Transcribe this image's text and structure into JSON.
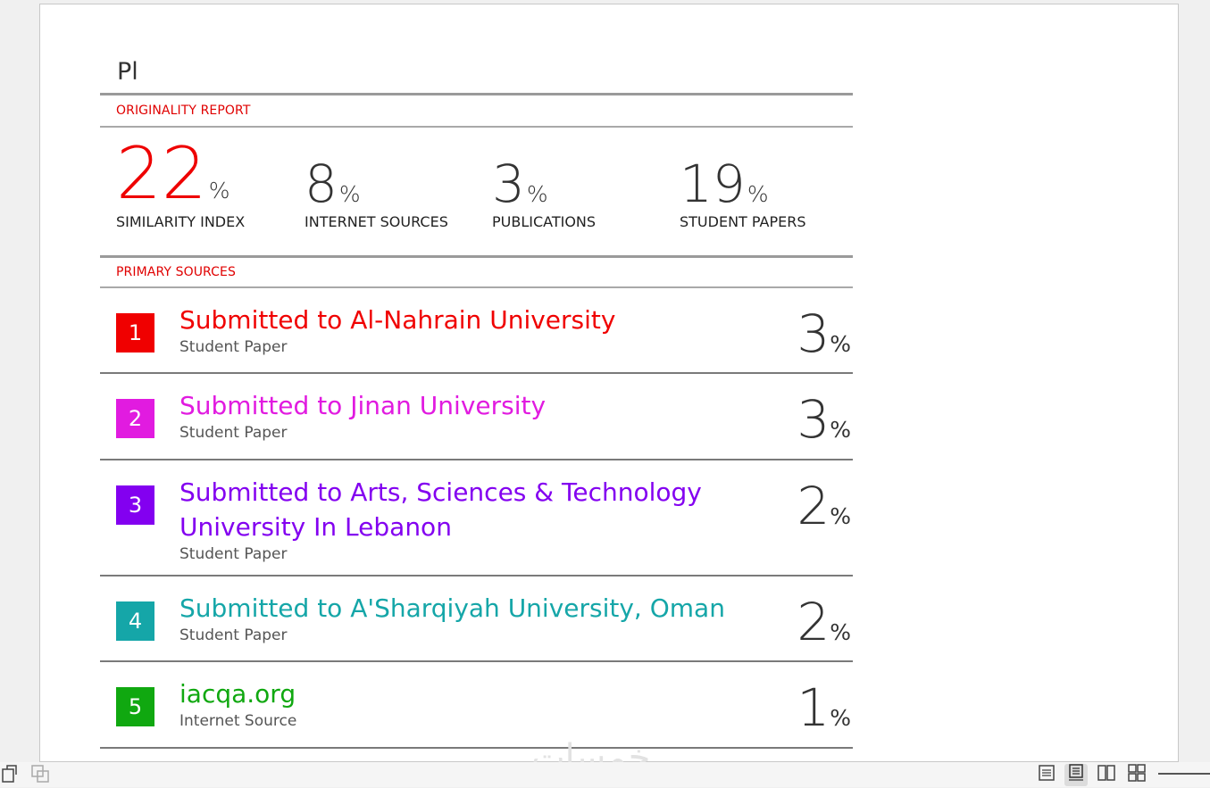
{
  "document": {
    "title": "Pl",
    "originality_label": "ORIGINALITY REPORT",
    "primary_sources_label": "PRIMARY SOURCES"
  },
  "stats": [
    {
      "value": "22",
      "pct": "%",
      "label": "SIMILARITY INDEX",
      "color": "#ee0000"
    },
    {
      "value": "8",
      "pct": "%",
      "label": "INTERNET SOURCES",
      "color": "#333333"
    },
    {
      "value": "3",
      "pct": "%",
      "label": "PUBLICATIONS",
      "color": "#333333"
    },
    {
      "value": "19",
      "pct": "%",
      "label": "STUDENT PAPERS",
      "color": "#333333"
    }
  ],
  "sources": [
    {
      "rank": "1",
      "title": "Submitted to Al-Nahrain University",
      "type": "Student Paper",
      "percent": "3",
      "pct": "%",
      "color": "#f00000"
    },
    {
      "rank": "2",
      "title": "Submitted to Jinan University",
      "type": "Student Paper",
      "percent": "3",
      "pct": "%",
      "color": "#e11be0"
    },
    {
      "rank": "3",
      "title": "Submitted to Arts, Sciences & Technology University In Lebanon",
      "type": "Student Paper",
      "percent": "2",
      "pct": "%",
      "color": "#8300f0"
    },
    {
      "rank": "4",
      "title": "Submitted to A'Sharqiyah University, Oman",
      "type": "Student Paper",
      "percent": "2",
      "pct": "%",
      "color": "#15a6a8"
    },
    {
      "rank": "5",
      "title": "iacqa.org",
      "type": "Internet Source",
      "percent": "1",
      "pct": "%",
      "color": "#10a810"
    }
  ],
  "watermark": "خمسات",
  "statusbar": {
    "icons": [
      "rotate-page-icon",
      "page-copy-icon",
      "single-page-view-icon",
      "scroll-view-icon",
      "two-page-view-icon",
      "multi-page-view-icon"
    ]
  }
}
